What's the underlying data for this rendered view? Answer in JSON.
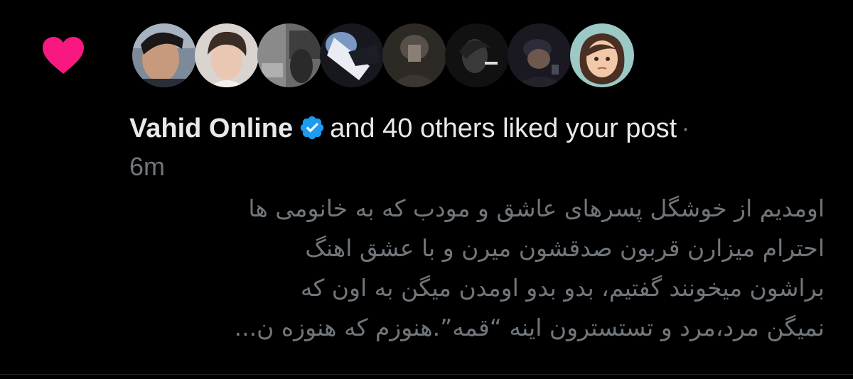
{
  "notification": {
    "type_icon": "heart-icon",
    "icon_color": "#f91880",
    "avatars": [
      {
        "name": "avatar-1"
      },
      {
        "name": "avatar-2"
      },
      {
        "name": "avatar-3"
      },
      {
        "name": "avatar-4"
      },
      {
        "name": "avatar-5"
      },
      {
        "name": "avatar-6"
      },
      {
        "name": "avatar-7"
      },
      {
        "name": "avatar-8"
      }
    ],
    "user_name": "Vahid Online",
    "verified_icon": "verified-badge-icon",
    "verified_color": "#1d9bf0",
    "action_text": "and 40 others liked your post",
    "separator": "·",
    "timestamp": "6m",
    "post_lines": [
      "اومدیم از خوشگل پسرهای عاشق و مودب که به خانومی ها",
      "احترام میزارن قربون صدقشون میرن و با عشق اهنگ",
      "براشون میخونند گفتیم، بدو بدو اومدن میگن به اون که",
      "نمیگن مرد،مرد و تستسترون اینه “قمه”.هنوزم که هنوزه ن..."
    ]
  }
}
